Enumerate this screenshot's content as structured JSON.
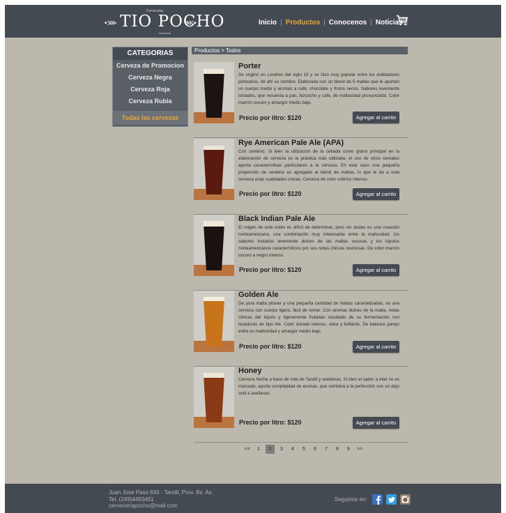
{
  "header": {
    "logo_text": "TIO POCHO",
    "logo_tag_top": "Cerveceria",
    "logo_tag_bottom": "Artesanal",
    "nav": [
      {
        "label": "Inicio",
        "active": false
      },
      {
        "label": "Productos",
        "active": true
      },
      {
        "label": "Conocenos",
        "active": false
      },
      {
        "label": "Noticias",
        "active": false
      }
    ],
    "cart_icon": "shopping-cart-icon"
  },
  "sidebar": {
    "title": "CATEGORIAS",
    "items": [
      {
        "label": "Cerveza de Promocion",
        "active": false
      },
      {
        "label": "Cerveza Negra",
        "active": false
      },
      {
        "label": "Cerveza Roja",
        "active": false
      },
      {
        "label": "Cerveza Rubia",
        "active": false
      },
      {
        "label": "Todas las cervezas",
        "active": true
      }
    ]
  },
  "breadcrumb": "Productos > Todos",
  "products": [
    {
      "name": "Porter",
      "description": "Se originó en Londres del siglo 18 y se hizo muy popular entre los estibadores portuarios, de ahí su nombre. Elaborada con un blend de 5 maltas que le aportan un cuerpo medio y aromas a café, chocolate y frutos secos. Sabores levemente tostados, que recuerda a pan, bizcocho y café, de maltosidad pronunciada. Color marrón oscuro y amargor medio bajo.",
      "price": "Precio por litro: $120",
      "button": "Agregar al carrito",
      "beer_color": "#1c1412"
    },
    {
      "name": "Rye American Pale Ale (APA)",
      "description": "Con centeno. Si bien la utilización de la cebada como grano principal en la elaboración de cerveza es la práctica más utilizada, el uso de otros cereales aporta características particulares a la cerveza. En este caso una pequeña proporción de centeno es agregado al blend de maltas, lo que le da a esta cerveza unas cualidades únicas. Cerveza de color cobrizo intenso.",
      "price": "Precio por litro: $120",
      "button": "Agregar al carrito",
      "beer_color": "#5a1a10"
    },
    {
      "name": "Black Indian Pale Ale",
      "description": "El origen de este estilo es difícil de determinar, pero sin dudas es una creación norteamericana, una combinación muy interesante entre la maltosidad, los sabores tostados levemente dulces de las maltas oscuras y los lúpulos norteamericanos característicos por sus notas cítricas resinosas. De color marrón oscuro a negro intenso.",
      "price": "Precio por litro: $120",
      "button": "Agregar al carrito",
      "beer_color": "#1a1210"
    },
    {
      "name": "Golden Ale",
      "description": "De pura malta pilsner y una pequeña cantidad de maltas caramelizadas, es una cerveza con cuerpo ligero, fácil de tomar. Con aromas dulces de la malta, notas cítricas del lúpulo y ligeramente frutadas resultado de su fermentación con levaduras de tipo Ale. Color dorado intenso, clara y brillante. De balance parejo entre su maltosidad y amargor medio bajo.",
      "price": "Precio por litro: $120",
      "button": "Agregar al carrito",
      "beer_color": "#c8741a"
    },
    {
      "name": "Honey",
      "description": "Cerveza hecha a base de miel de Tandil y avellanas. Si bien el sabor a miel no es marcado, aporta complejidad de aromas, que combina a la perfección con un dejo sutil a avellanas.",
      "price": "Precio por litro: $120",
      "button": "Agregar al carrito",
      "beer_color": "#8a3a14"
    }
  ],
  "pagination": {
    "prev": "<<",
    "next": ">>",
    "pages": [
      "1",
      "2",
      "3",
      "4",
      "5",
      "6",
      "7",
      "8",
      "9"
    ],
    "current": "2"
  },
  "footer": {
    "address_line1": "Juan Jose Paso 693 - Tandil, Prov. Bs. As.",
    "phone": "Tel. (249)4493461",
    "email": "cerveceriapocho@mail.com",
    "follow_label": "Seguinos en:",
    "social": [
      {
        "icon": "facebook-icon",
        "color": "#3b6fc4"
      },
      {
        "icon": "twitter-icon",
        "color": "#2e9fe0"
      },
      {
        "icon": "instagram-icon",
        "color": "#8b7a6a"
      }
    ]
  }
}
